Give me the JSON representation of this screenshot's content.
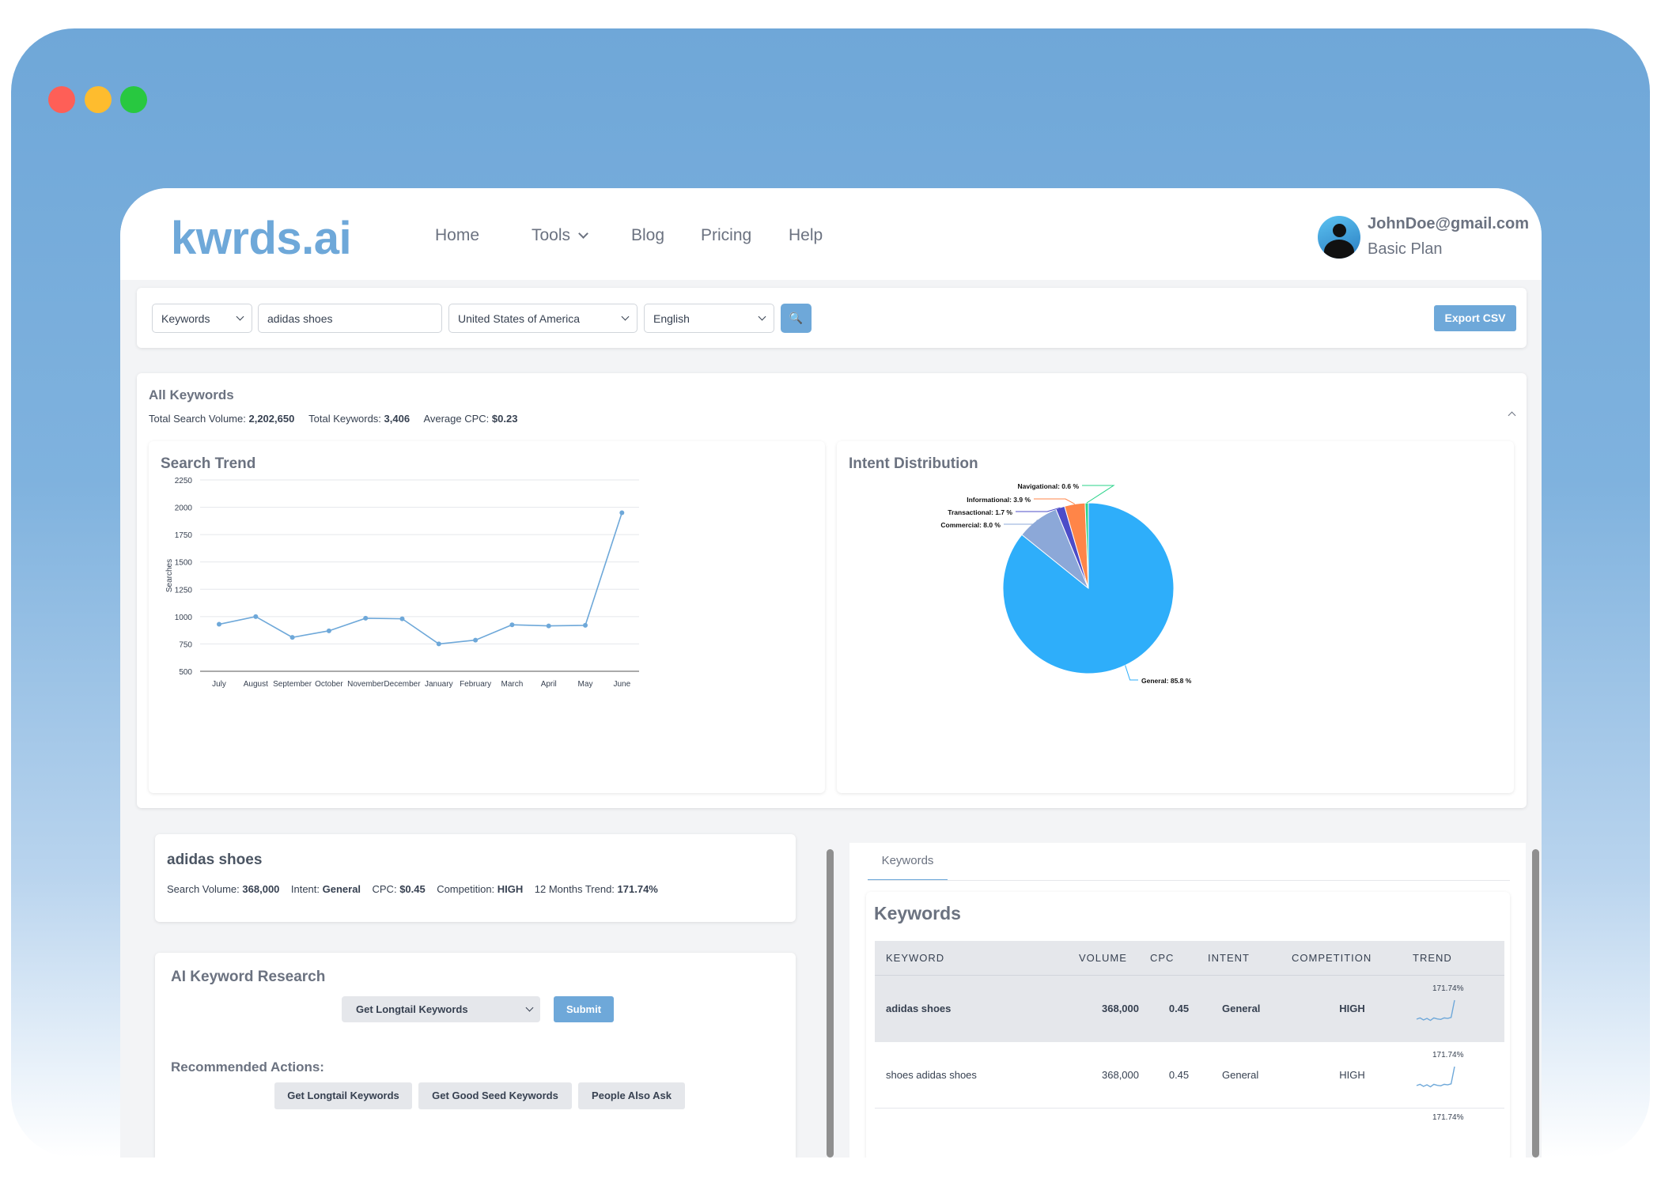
{
  "nav": {
    "logo": "kwrds.ai",
    "links": [
      "Home",
      "Tools",
      "Blog",
      "Pricing",
      "Help"
    ],
    "user_email": "JohnDoe@gmail.com",
    "user_plan": "Basic Plan"
  },
  "search": {
    "type": "Keywords",
    "query": "adidas shoes",
    "country": "United States of America",
    "language": "English",
    "search_icon": "🔍",
    "export_label": "Export CSV"
  },
  "all_keywords": {
    "title": "All Keywords",
    "total_volume_label": "Total Search Volume:",
    "total_volume": "2,202,650",
    "total_keywords_label": "Total Keywords:",
    "total_keywords": "3,406",
    "avg_cpc_label": "Average CPC:",
    "avg_cpc": "$0.23"
  },
  "trend": {
    "title": "Search Trend"
  },
  "intent": {
    "title": "Intent Distribution"
  },
  "chart_data": [
    {
      "type": "line",
      "title": "Search Trend",
      "ylabel": "Searches",
      "xlabel": "",
      "categories": [
        "July",
        "August",
        "September",
        "October",
        "November",
        "December",
        "January",
        "February",
        "March",
        "April",
        "May",
        "June"
      ],
      "values": [
        930,
        1000,
        810,
        870,
        985,
        980,
        750,
        785,
        925,
        915,
        920,
        1950
      ],
      "ylim": [
        500,
        2250
      ],
      "yticks": [
        500,
        750,
        1000,
        1250,
        1500,
        1750,
        2000,
        2250
      ],
      "grid": true,
      "color": "#6ea8d9"
    },
    {
      "type": "pie",
      "title": "Intent Distribution",
      "slices": [
        {
          "label": "General",
          "value": 85.8,
          "display": "General: 85.8 %",
          "color": "#2eaefa"
        },
        {
          "label": "Commercial",
          "value": 8.0,
          "display": "Commercial: 8.0 %",
          "color": "#8ca8d8"
        },
        {
          "label": "Transactional",
          "value": 1.7,
          "display": "Transactional: 1.7 %",
          "color": "#4c4cc8"
        },
        {
          "label": "Informational",
          "value": 3.9,
          "display": "Informational: 3.9 %",
          "color": "#ff8548"
        },
        {
          "label": "Navigational",
          "value": 0.6,
          "display": "Navigational: 0.6 %",
          "color": "#2ad38a"
        }
      ]
    }
  ],
  "summary": {
    "keyword": "adidas shoes",
    "volume_label": "Search Volume:",
    "volume": "368,000",
    "intent_label": "Intent:",
    "intent": "General",
    "cpc_label": "CPC:",
    "cpc": "$0.45",
    "competition_label": "Competition:",
    "competition": "HIGH",
    "trend_label": "12 Months Trend:",
    "trend": "171.74%"
  },
  "ai": {
    "title": "AI Keyword Research",
    "select": "Get Longtail Keywords",
    "submit": "Submit",
    "recommended_title": "Recommended Actions:",
    "actions": [
      "Get Longtail Keywords",
      "Get Good Seed Keywords",
      "People Also Ask"
    ]
  },
  "keywords_panel": {
    "tab": "Keywords",
    "title": "Keywords",
    "columns": [
      "KEYWORD",
      "VOLUME",
      "CPC",
      "INTENT",
      "COMPETITION",
      "TREND"
    ],
    "rows": [
      {
        "keyword": "adidas shoes",
        "volume": "368,000",
        "cpc": "0.45",
        "intent": "General",
        "competition": "HIGH",
        "trend": "171.74%",
        "spark": [
          0.25,
          0.3,
          0.22,
          0.28,
          0.2,
          0.3,
          0.26,
          0.24,
          0.3,
          0.28,
          0.32,
          1.0
        ]
      },
      {
        "keyword": "shoes adidas shoes",
        "volume": "368,000",
        "cpc": "0.45",
        "intent": "General",
        "competition": "HIGH",
        "trend": "171.74%",
        "spark": [
          0.25,
          0.3,
          0.22,
          0.28,
          0.2,
          0.3,
          0.26,
          0.24,
          0.3,
          0.28,
          0.32,
          1.0
        ]
      },
      {
        "keyword": "",
        "volume": "",
        "cpc": "",
        "intent": "",
        "competition": "",
        "trend": "171.74%",
        "spark": []
      }
    ]
  }
}
